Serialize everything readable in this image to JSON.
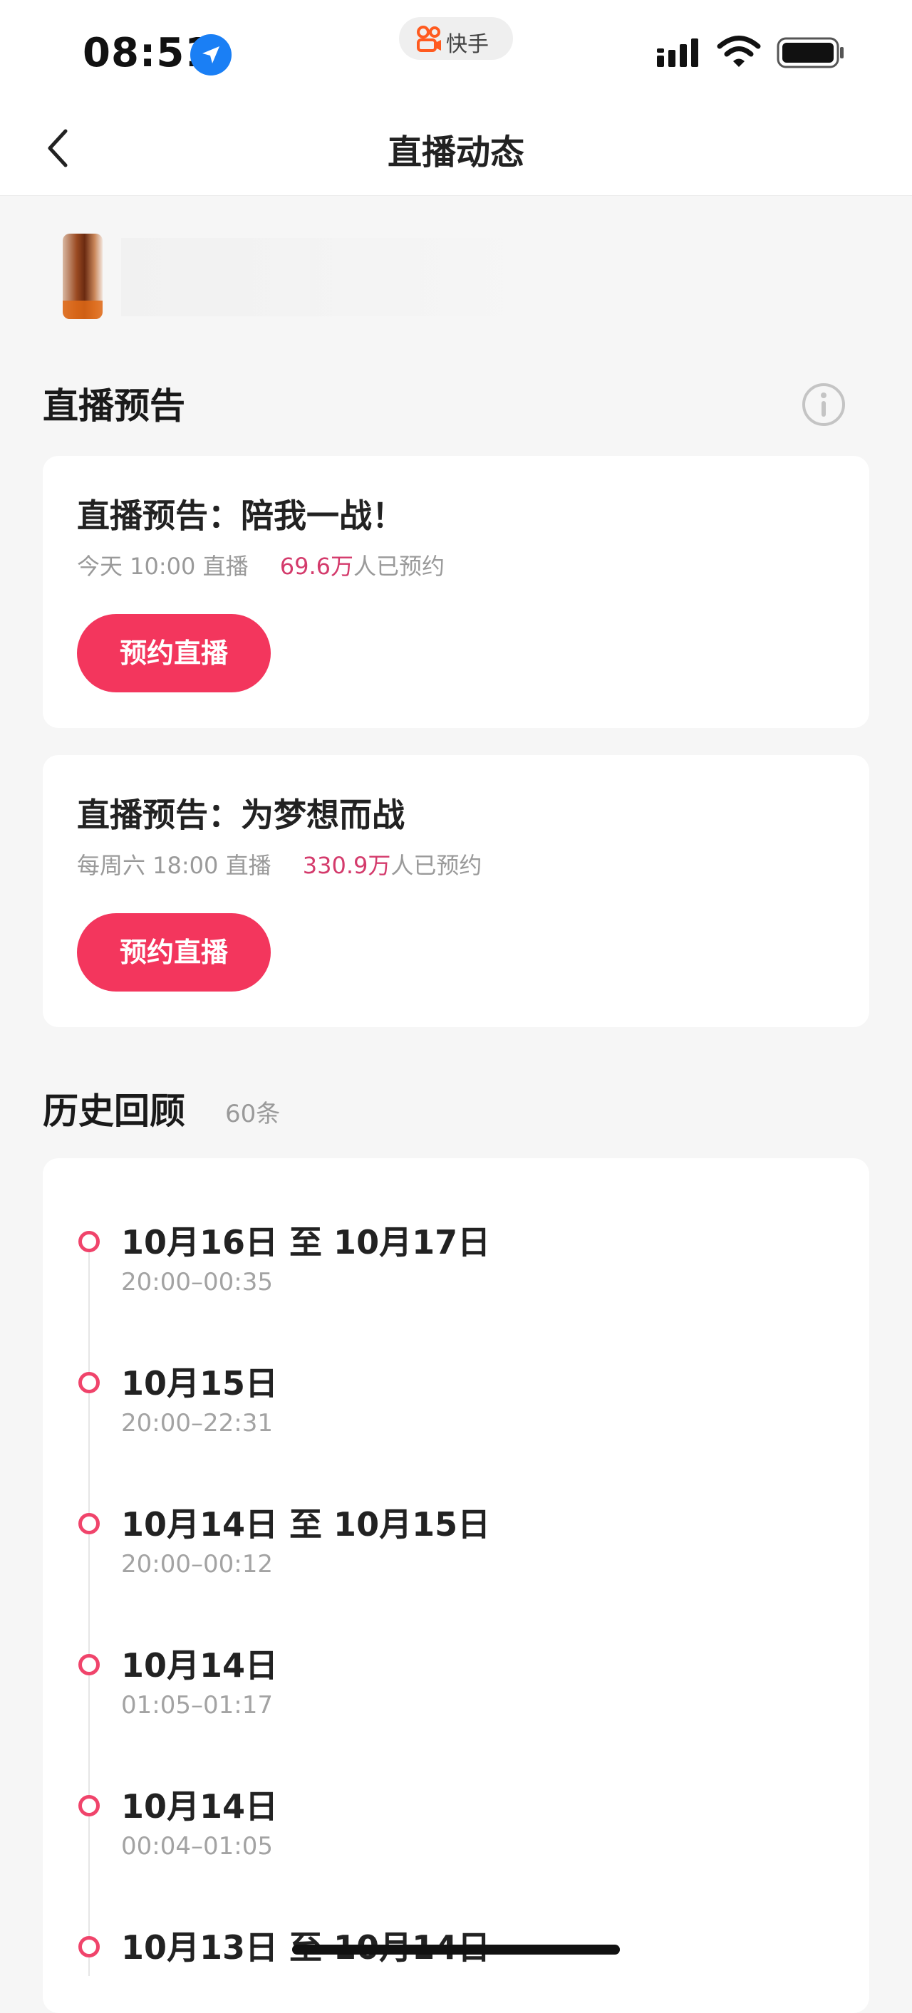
{
  "status_bar": {
    "time": "08:51",
    "app_name": "快手",
    "icons": [
      "location-arrow-icon",
      "kuaishou-logo-icon",
      "cellular-signal-icon",
      "wifi-icon",
      "battery-icon"
    ]
  },
  "nav": {
    "back_icon": "chevron-left-icon",
    "title": "直播动态"
  },
  "preview_section": {
    "title": "直播预告",
    "info_icon": "info-icon",
    "cards": [
      {
        "title": "直播预告：陪我一战！",
        "schedule": "今天 10:00 直播",
        "count": "69.6万",
        "count_suffix": "人已预约",
        "button": "预约直播"
      },
      {
        "title": "直播预告：为梦想而战",
        "schedule": "每周六 18:00 直播",
        "count": "330.9万",
        "count_suffix": "人已预约",
        "button": "预约直播"
      }
    ]
  },
  "history_section": {
    "title": "历史回顾",
    "count": "60条",
    "items": [
      {
        "date": "10月16日 至 10月17日",
        "time": "20:00–00:35"
      },
      {
        "date": "10月15日",
        "time": "20:00–22:31"
      },
      {
        "date": "10月14日 至 10月15日",
        "time": "20:00–00:12"
      },
      {
        "date": "10月14日",
        "time": "01:05–01:17"
      },
      {
        "date": "10月14日",
        "time": "00:04–01:05"
      },
      {
        "date": "10月13日 至 10月14日",
        "time": ""
      }
    ]
  },
  "colors": {
    "accent": "#f3365d",
    "highlight_text": "#d43b6c",
    "background": "#f6f6f6",
    "card": "#ffffff"
  }
}
